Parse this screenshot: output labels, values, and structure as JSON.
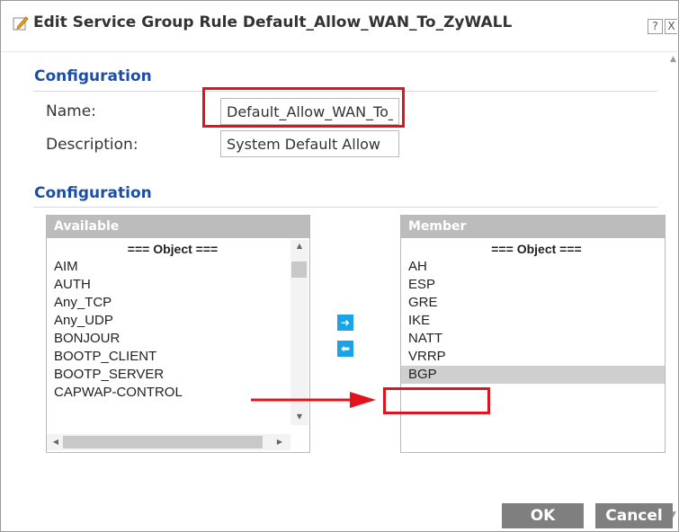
{
  "dialog": {
    "title": "Edit Service Group Rule Default_Allow_WAN_To_ZyWALL",
    "help_label": "?",
    "close_label": "X"
  },
  "config1": {
    "section_title": "Configuration",
    "name_label": "Name:",
    "name_value": "Default_Allow_WAN_To_ZyWALL",
    "description_label": "Description:",
    "description_value": "System Default Allow"
  },
  "config2": {
    "section_title": "Configuration",
    "available": {
      "header": "Available",
      "items": [
        "=== Object ===",
        "AIM",
        "AUTH",
        "Any_TCP",
        "Any_UDP",
        "BONJOUR",
        "BOOTP_CLIENT",
        "BOOTP_SERVER",
        "CAPWAP-CONTROL"
      ]
    },
    "member": {
      "header": "Member",
      "items": [
        "=== Object ===",
        "AH",
        "ESP",
        "GRE",
        "IKE",
        "NATT",
        "VRRP",
        "BGP"
      ],
      "selected_item": "BGP"
    },
    "add_icon": "arrow-right-icon",
    "remove_icon": "arrow-left-icon"
  },
  "footer": {
    "ok_label": "OK",
    "cancel_label": "Cancel"
  },
  "colors": {
    "section_title": "#1c4fa3",
    "highlight": "#e0141a",
    "move_button": "#1aa3e8",
    "list_header": "#bcbcbc",
    "footer_button": "#7f7f7f"
  }
}
